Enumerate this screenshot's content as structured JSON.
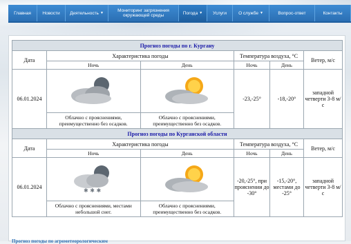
{
  "nav": {
    "items": [
      {
        "label": "Главная",
        "caret": ""
      },
      {
        "label": "Новости",
        "caret": ""
      },
      {
        "label": "Деятельность",
        "caret": "▼"
      },
      {
        "label": "Мониторинг загрязнения окружающей среды",
        "caret": ""
      },
      {
        "label": "Погода",
        "caret": "▼"
      },
      {
        "label": "Услуги",
        "caret": ""
      },
      {
        "label": "О службе",
        "caret": "▼"
      },
      {
        "label": "Вопрос-ответ",
        "caret": ""
      },
      {
        "label": "Контакты",
        "caret": ""
      }
    ],
    "active_index": 4
  },
  "tables": [
    {
      "title": "Прогноз погоды по г. Кургану",
      "head": {
        "date": "Дата",
        "char": "Характеристика погоды",
        "temp": "Температура воздуха, °С",
        "wind": "Ветер, м/с",
        "night": "Ночь",
        "day": "День"
      },
      "row": {
        "date": "06.01.2024",
        "night_icon": "cloudy-night-icon",
        "day_icon": "partly-cloudy-sun-icon",
        "night_desc": "Облачно с прояснениями, преимущественно без осадков.",
        "day_desc": "Облачно с прояснениями, преимущественно без осадков.",
        "t_night": "-23,-25°",
        "t_day": "-18,-20°",
        "wind": "западной четверти 3-8 м/с"
      }
    },
    {
      "title": "Прогноз погоды по Курганской области",
      "head": {
        "date": "Дата",
        "char": "Характеристика погоды",
        "temp": "Температура воздуха, °С",
        "wind": "Ветер, м/с",
        "night": "Ночь",
        "day": "День"
      },
      "row": {
        "date": "06.01.2024",
        "night_icon": "snowy-night-icon",
        "day_icon": "partly-cloudy-sun-icon",
        "night_desc": "Облачно с прояснениями, местами небольшой снег.",
        "day_desc": "Облачно с прояснениями, преимущественно без осадков.",
        "t_night": "-20,-25°, при прояснении до -30°",
        "t_day": "-15,-20°, местами до -25°",
        "wind": "западной четверти 3-8 м/с"
      }
    }
  ],
  "footer": {
    "text": "Прогноз погоды по агрометеорологическим"
  }
}
